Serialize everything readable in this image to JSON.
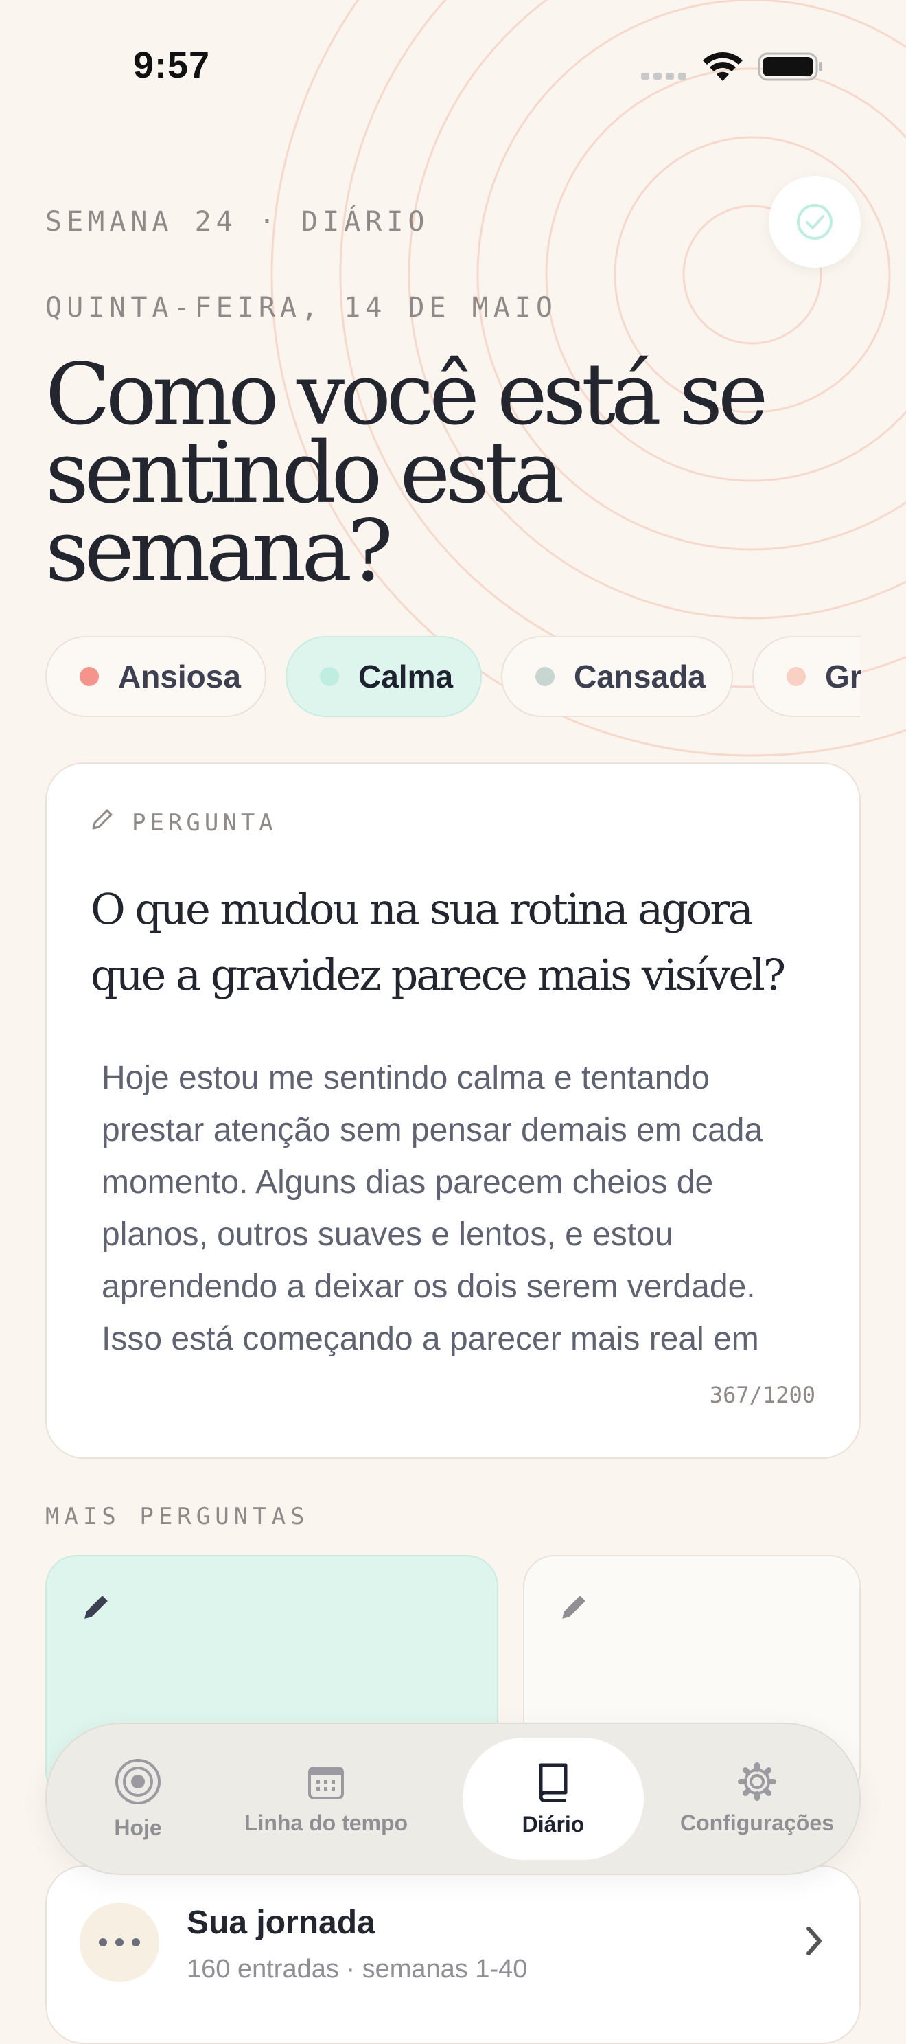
{
  "status": {
    "time": "9:57"
  },
  "header": {
    "week_label": "SEMANA 24 · DIÁRIO",
    "date_label": "QUINTA-FEIRA, 14 DE MAIO",
    "title_line1": "Como você está se",
    "title_line2": "sentindo esta semana?"
  },
  "moods": [
    {
      "label": "Ansiosa",
      "color": "#f4948a",
      "selected": false
    },
    {
      "label": "Calma",
      "color": "#bfeee0",
      "selected": true
    },
    {
      "label": "Cansada",
      "color": "#c7d6d0",
      "selected": false
    },
    {
      "label": "Grata",
      "color": "#f8d0c4",
      "selected": false
    }
  ],
  "prompt_card": {
    "label": "PERGUNTA",
    "question": "O que mudou na sua rotina agora que a gravidez parece mais visível?",
    "answer": "Hoje estou me sentindo calma e tentando prestar atenção sem pensar demais em cada momento. Alguns dias parecem cheios de planos, outros suaves e lentos, e estou aprendendo a deixar os dois serem verdade. Isso está começando a parecer mais real em",
    "counter": "367/1200"
  },
  "more_questions": {
    "label": "MAIS PERGUNTAS"
  },
  "nav": {
    "tabs": [
      {
        "label": "Hoje",
        "icon": "radar-icon",
        "active": false
      },
      {
        "label": "Linha do tempo",
        "icon": "calendar-icon",
        "active": false
      },
      {
        "label": "Diário",
        "icon": "book-icon",
        "active": true
      },
      {
        "label": "Configurações",
        "icon": "gear-icon",
        "active": false
      }
    ]
  },
  "journey": {
    "title": "Sua jornada",
    "subtitle": "160 entradas · semanas 1-40"
  },
  "colors": {
    "background": "#faf5ef",
    "accent_mint": "#def5ee",
    "ring": "#f6d9cc",
    "text": "#23252f"
  }
}
